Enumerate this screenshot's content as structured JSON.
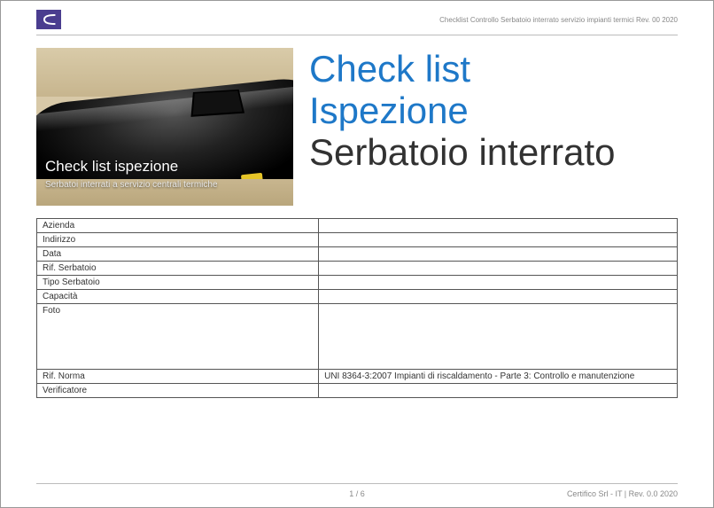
{
  "header": {
    "doc_title": "Checklist Controllo Serbatoio interrato servizio impianti termici Rev. 00 2020"
  },
  "photo": {
    "overlay_title": "Check list ispezione",
    "overlay_sub": "Serbatoi interrati a servizio centrali termiche"
  },
  "title": {
    "line1": "Check list",
    "line2": "Ispezione",
    "line3": "Serbatoio interrato"
  },
  "table": {
    "rows": [
      {
        "label": "Azienda",
        "value": ""
      },
      {
        "label": "Indirizzo",
        "value": ""
      },
      {
        "label": "Data",
        "value": ""
      },
      {
        "label": "Rif. Serbatoio",
        "value": ""
      },
      {
        "label": "Tipo Serbatoio",
        "value": ""
      },
      {
        "label": "Capacità",
        "value": ""
      },
      {
        "label": "Foto",
        "value": "",
        "tall": true
      },
      {
        "label": "Rif. Norma",
        "value": "UNI 8364-3:2007 Impianti di riscaldamento - Parte 3: Controllo e manutenzione"
      },
      {
        "label": "Verificatore",
        "value": ""
      }
    ]
  },
  "footer": {
    "page": "1 / 6",
    "right": "Certifico Srl - IT | Rev. 0.0 2020"
  }
}
